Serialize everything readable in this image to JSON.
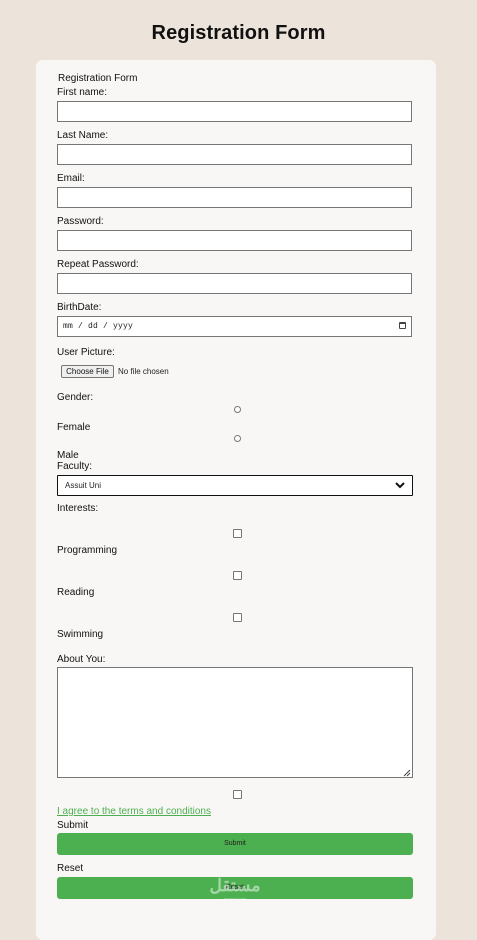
{
  "page": {
    "title": "Registration Form"
  },
  "form": {
    "legend": "Registration Form",
    "first_name": {
      "label": "First name:",
      "value": ""
    },
    "last_name": {
      "label": "Last Name:",
      "value": ""
    },
    "email": {
      "label": "Email:",
      "value": ""
    },
    "password": {
      "label": "Password:",
      "value": ""
    },
    "repeat_password": {
      "label": "Repeat Password:",
      "value": ""
    },
    "birthdate": {
      "label": "BirthDate:",
      "placeholder": "mm / dd / yyyy",
      "icon": "calendar-icon"
    },
    "user_picture": {
      "label": "User Picture:",
      "button_label": "Choose File",
      "status": "No file chosen"
    },
    "gender": {
      "label": "Gender:",
      "options": [
        {
          "label": "Female",
          "checked": false
        },
        {
          "label": "Male",
          "checked": false
        }
      ]
    },
    "faculty": {
      "label": "Faculty:",
      "selected": "Assuit Uni",
      "icon": "chevron-down-icon"
    },
    "interests": {
      "label": "Interests:",
      "options": [
        {
          "label": "Programming",
          "checked": false
        },
        {
          "label": "Reading",
          "checked": false
        },
        {
          "label": "Swimming",
          "checked": false
        }
      ]
    },
    "about": {
      "label": "About You:",
      "value": ""
    },
    "terms": {
      "label": "I agree to the terms and conditions",
      "checked": false
    },
    "submit": {
      "label": "Submit",
      "button_label": "Submit"
    },
    "reset": {
      "label": "Reset",
      "button_label": "Reset"
    }
  },
  "watermark": {
    "text": "مستقل",
    "subtext": "mostaql.com"
  },
  "colors": {
    "page_bg": "#ece3da",
    "card_bg": "#f9f7f5",
    "accent": "#4caf50",
    "border": "#767676"
  }
}
